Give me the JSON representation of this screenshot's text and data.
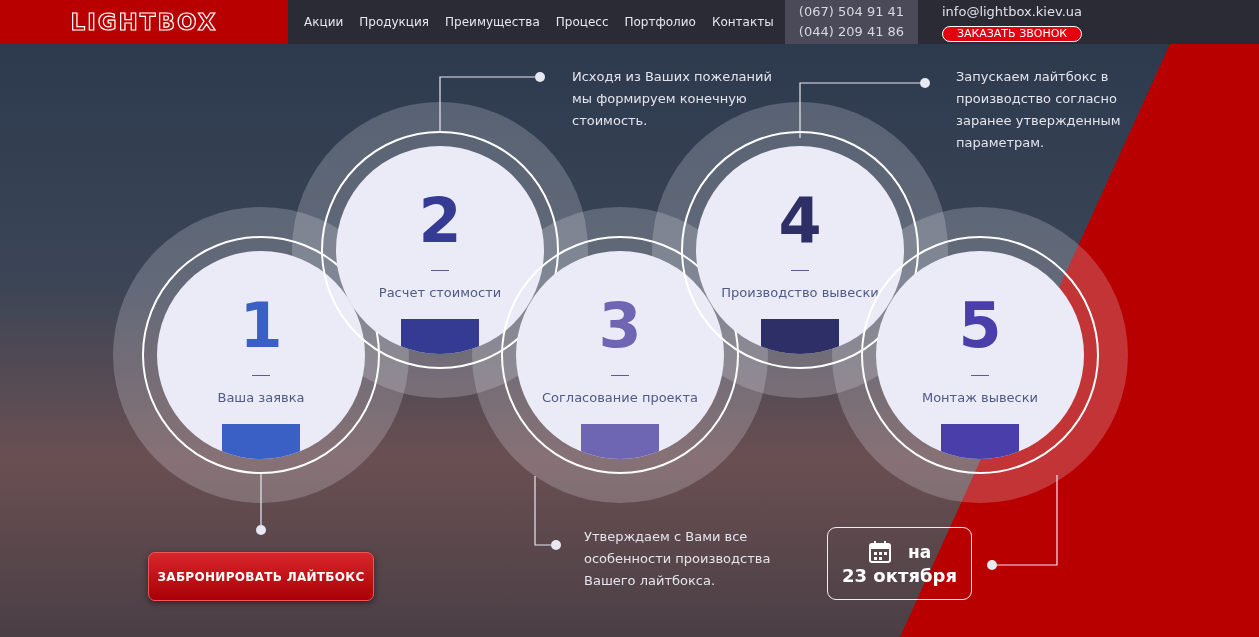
{
  "header": {
    "logo": "LIGHTBOX",
    "nav": [
      {
        "label": "Акции"
      },
      {
        "label": "Продукция"
      },
      {
        "label": "Преимущества"
      },
      {
        "label": "Процесс"
      },
      {
        "label": "Портфолио"
      },
      {
        "label": "Контакты"
      }
    ],
    "phones": [
      "(067) 504 91 41",
      "(044) 209 41 86"
    ],
    "email": "info@lightbox.kiev.ua",
    "callback_button": "ЗАКАЗАТЬ ЗВОНОК"
  },
  "steps": [
    {
      "number": "1",
      "label": "Ваша заявка",
      "color": "#3a60c6"
    },
    {
      "number": "2",
      "label": "Расчет стоимости",
      "color": "#353b92"
    },
    {
      "number": "3",
      "label": "Согласование проекта",
      "color": "#6f66b3"
    },
    {
      "number": "4",
      "label": "Производство вывески",
      "color": "#2e2f66"
    },
    {
      "number": "5",
      "label": "Монтаж вывески",
      "color": "#4a3eaa"
    }
  ],
  "descriptions": [
    {
      "text": "Исходя из Ваших пожеланий мы формируем конечную стоимость."
    },
    {
      "text": "Запускаем лайтбокс в производство согласно заранее утвержденным параметрам."
    },
    {
      "text": "Утверждаем с Вами все особенности производства Вашего лайтбокса."
    }
  ],
  "book_button": "ЗАБРОНИРОВАТЬ ЛАЙТБОКС",
  "date_badge": {
    "line_1": "на",
    "line_2": "23 октября"
  }
}
